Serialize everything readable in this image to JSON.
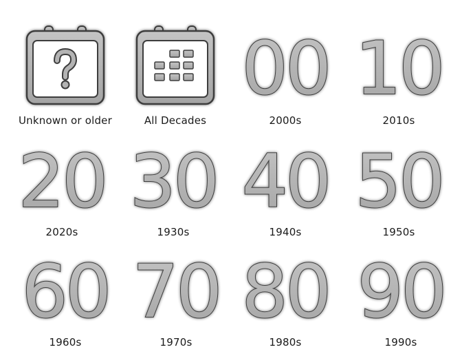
{
  "tiles": [
    {
      "id": "unknown",
      "label": "Unknown or older",
      "icon": "question-calendar-icon",
      "numeral": ""
    },
    {
      "id": "all",
      "label": "All Decades",
      "icon": "calendar-grid-icon",
      "numeral": ""
    },
    {
      "id": "2000s",
      "label": "2000s",
      "icon": "decade-00-icon",
      "numeral": "00"
    },
    {
      "id": "2010s",
      "label": "2010s",
      "icon": "decade-10-icon",
      "numeral": "10"
    },
    {
      "id": "2020s",
      "label": "2020s",
      "icon": "decade-20-icon",
      "numeral": "20"
    },
    {
      "id": "1930s",
      "label": "1930s",
      "icon": "decade-30-icon",
      "numeral": "30"
    },
    {
      "id": "1940s",
      "label": "1940s",
      "icon": "decade-40-icon",
      "numeral": "40"
    },
    {
      "id": "1950s",
      "label": "1950s",
      "icon": "decade-50-icon",
      "numeral": "50"
    },
    {
      "id": "1960s",
      "label": "1960s",
      "icon": "decade-60-icon",
      "numeral": "60"
    },
    {
      "id": "1970s",
      "label": "1970s",
      "icon": "decade-70-icon",
      "numeral": "70"
    },
    {
      "id": "1980s",
      "label": "1980s",
      "icon": "decade-80-icon",
      "numeral": "80"
    },
    {
      "id": "1990s",
      "label": "1990s",
      "icon": "decade-90-icon",
      "numeral": "90"
    }
  ],
  "colors": {
    "icon_fill": "#b3b3b3",
    "icon_stroke": "#3c3c3c",
    "label_text": "#1a1a1a",
    "background": "#ffffff"
  }
}
